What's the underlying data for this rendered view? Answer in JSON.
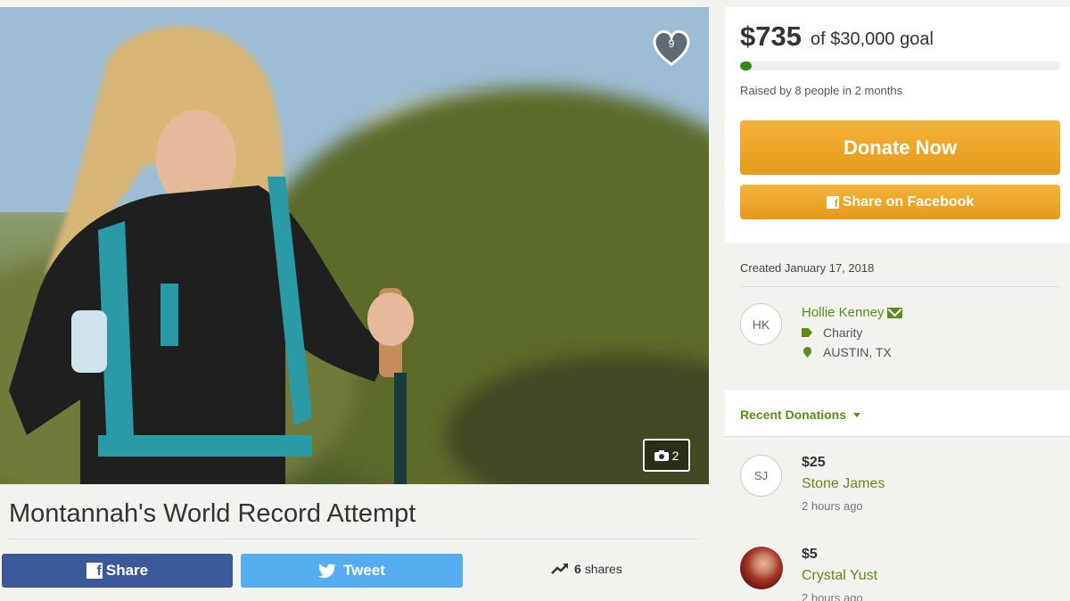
{
  "hero": {
    "heart_count": "9",
    "photo_count": "2"
  },
  "campaign": {
    "title": "Montannah's World Record Attempt"
  },
  "share_bar": {
    "facebook_label": "Share",
    "twitter_label": "Tweet",
    "shares_count": "6",
    "shares_label": "shares"
  },
  "funding": {
    "amount": "$735",
    "goal_text": "of $30,000 goal",
    "progress": 0.0245,
    "raised_text": "Raised by 8 people in 2 months",
    "donate_label": "Donate Now",
    "share_facebook_label": "Share on Facebook"
  },
  "organizer": {
    "created": "Created January 17, 2018",
    "initials": "HK",
    "name": "Hollie Kenney",
    "category": "Charity",
    "location": "AUSTIN, TX"
  },
  "recent": {
    "label": "Recent Donations",
    "donations": [
      {
        "initials": "SJ",
        "amount": "$25",
        "name": "Stone James",
        "time": "2 hours ago"
      },
      {
        "initials": "",
        "amount": "$5",
        "name": "Crystal Yust",
        "time": "2 hours ago"
      }
    ]
  },
  "colors": {
    "accent_green": "#5e8c1c",
    "donate_orange": "#f4b33a",
    "facebook_blue": "#3b5998",
    "twitter_blue": "#55acee"
  },
  "icons": [
    "heart-icon",
    "camera-icon",
    "facebook-icon",
    "twitter-icon",
    "trend-icon",
    "mail-icon",
    "tag-icon",
    "pin-icon",
    "caret-icon"
  ]
}
